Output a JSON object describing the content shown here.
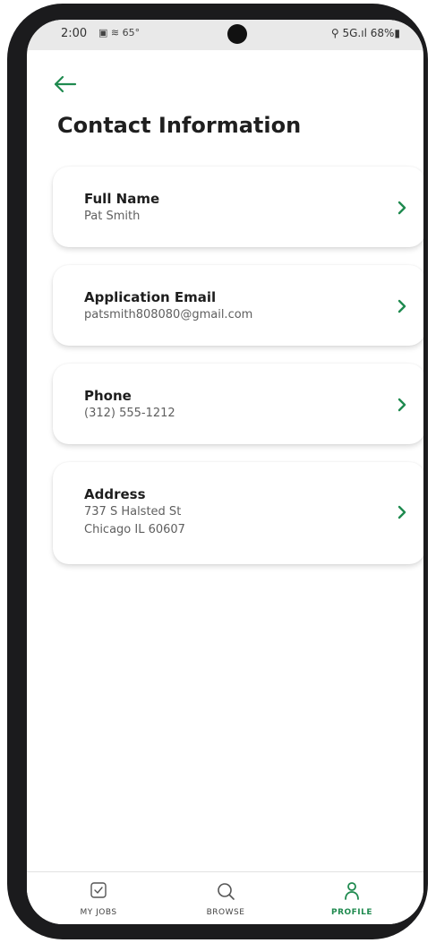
{
  "status_bar": {
    "time": "2:00",
    "left_icons": "▣ ≋ 65°",
    "right": "⚲ 5G.ıl 68%▮"
  },
  "page": {
    "title": "Contact Information"
  },
  "cards": [
    {
      "label": "Full Name",
      "value": "Pat Smith"
    },
    {
      "label": "Application Email",
      "value": "patsmith808080@gmail.com"
    },
    {
      "label": "Phone",
      "value": "(312) 555-1212"
    },
    {
      "label": "Address",
      "value": "737 S Halsted St",
      "value2": "Chicago IL 60607"
    }
  ],
  "nav": {
    "items": [
      {
        "label": "MY JOBS",
        "icon": "checkbox-icon"
      },
      {
        "label": "BROWSE",
        "icon": "search-icon"
      },
      {
        "label": "PROFILE",
        "icon": "person-icon",
        "active": true
      }
    ]
  },
  "colors": {
    "accent": "#1f8a4f",
    "title": "#1f1f1f",
    "secondary_text": "#5f5f5f"
  }
}
